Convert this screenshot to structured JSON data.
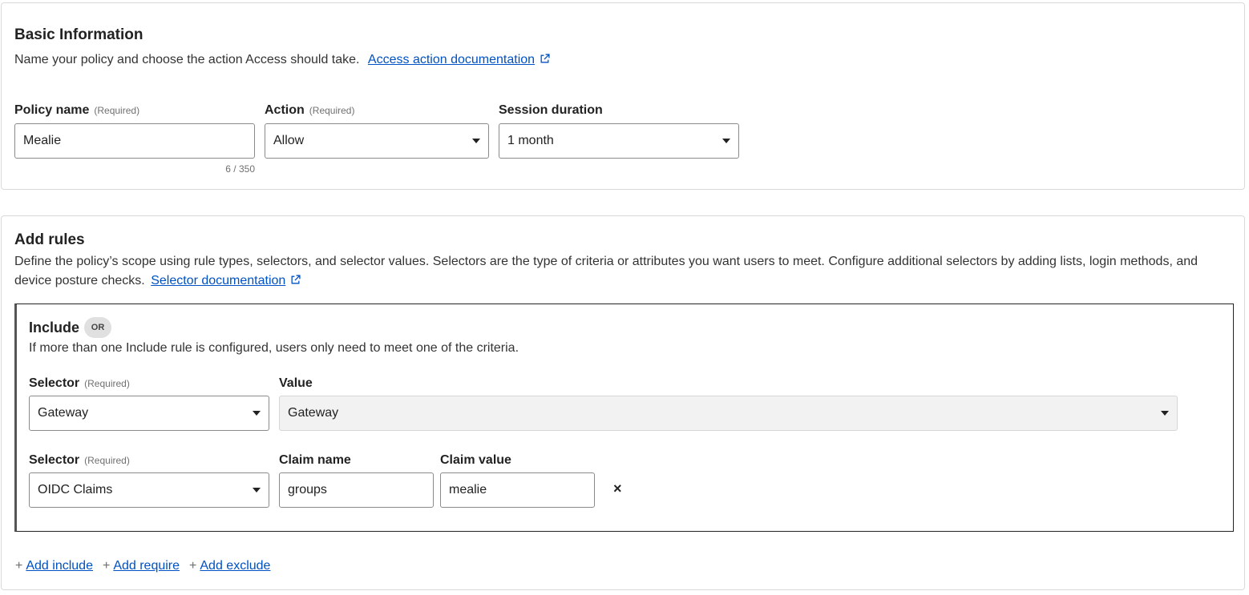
{
  "basic": {
    "title": "Basic Information",
    "description": "Name your policy and choose the action Access should take.",
    "doc_link": "Access action documentation",
    "policy_name": {
      "label": "Policy name",
      "required": "(Required)",
      "value": "Mealie",
      "counter": "6 / 350"
    },
    "action": {
      "label": "Action",
      "required": "(Required)",
      "value": "Allow"
    },
    "session": {
      "label": "Session duration",
      "value": "1 month"
    }
  },
  "rules": {
    "title": "Add rules",
    "description": "Define the policy’s scope using rule types, selectors, and selector values. Selectors are the type of criteria or attributes you want users to meet. Configure additional selectors by adding lists, login methods, and device posture checks.",
    "doc_link": "Selector documentation",
    "include": {
      "title": "Include",
      "badge": "OR",
      "description": "If more than one Include rule is configured, users only need to meet one of the criteria.",
      "rule1": {
        "selector_label": "Selector",
        "required": "(Required)",
        "selector_value": "Gateway",
        "value_label": "Value",
        "value": "Gateway"
      },
      "rule2": {
        "selector_label": "Selector",
        "required": "(Required)",
        "selector_value": "OIDC Claims",
        "claim_name_label": "Claim name",
        "claim_name": "groups",
        "claim_value_label": "Claim value",
        "claim_value": "mealie",
        "remove": "×"
      }
    },
    "actions": {
      "add_include": "Add include",
      "add_require": "Add require",
      "add_exclude": "Add exclude",
      "plus": "+"
    }
  },
  "icons": {
    "external": "external-link-icon",
    "caret": "chevron-down-icon",
    "remove": "close-icon"
  },
  "colors": {
    "link": "#0051c3",
    "border": "#d9d9d9",
    "disabled_bg": "#f2f2f2"
  }
}
